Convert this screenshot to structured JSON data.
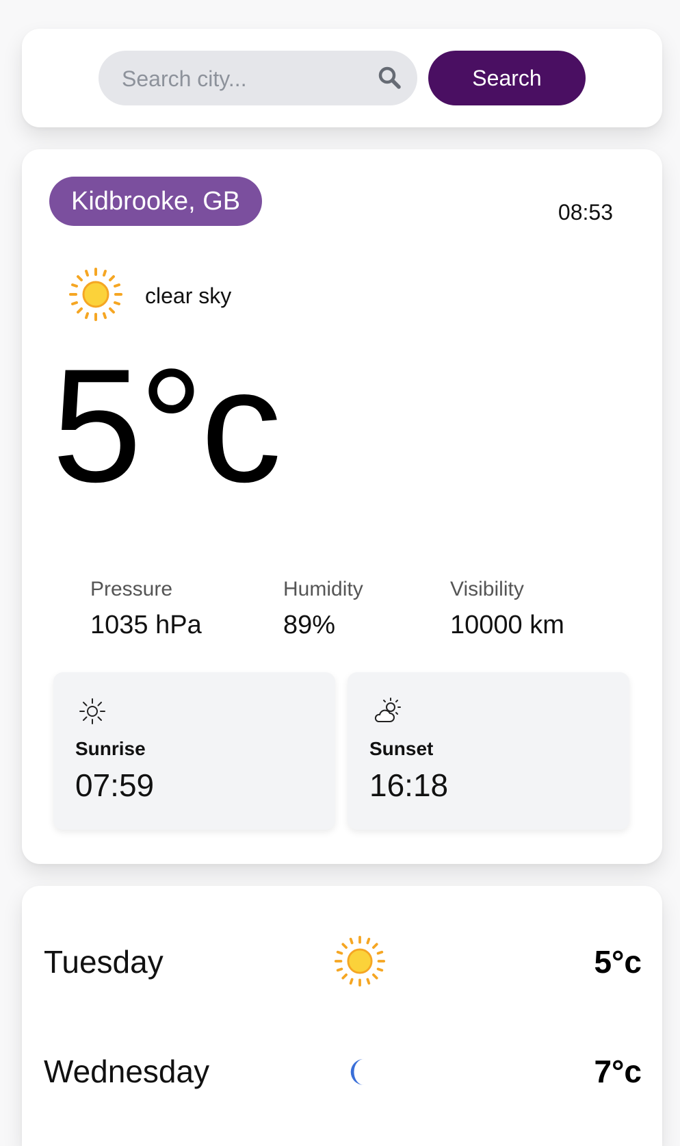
{
  "search": {
    "placeholder": "Search city...",
    "button_label": "Search"
  },
  "current": {
    "location": "Kidbrooke, GB",
    "time": "08:53",
    "condition": "clear sky",
    "condition_icon": "sun-icon",
    "temperature": "5°c"
  },
  "stats": [
    {
      "label": "Pressure",
      "value": "1035 hPa"
    },
    {
      "label": "Humidity",
      "value": "89%"
    },
    {
      "label": "Visibility",
      "value": "10000 km"
    }
  ],
  "sun": {
    "sunrise": {
      "label": "Sunrise",
      "value": "07:59",
      "icon": "sun-outline-icon"
    },
    "sunset": {
      "label": "Sunset",
      "value": "16:18",
      "icon": "cloud-sun-outline-icon"
    }
  },
  "forecast": [
    {
      "day": "Tuesday",
      "icon": "sun-icon",
      "temp": "5°c"
    },
    {
      "day": "Wednesday",
      "icon": "moon-icon",
      "temp": "7°c"
    }
  ],
  "colors": {
    "search_button_bg": "#4a0f62",
    "location_badge_bg": "#7b4f9e",
    "search_box_bg": "#e5e6ea",
    "sun_yellow": "#fbd23a",
    "sun_ray_orange": "#f5a623",
    "moon_blue": "#3a6fd8"
  }
}
